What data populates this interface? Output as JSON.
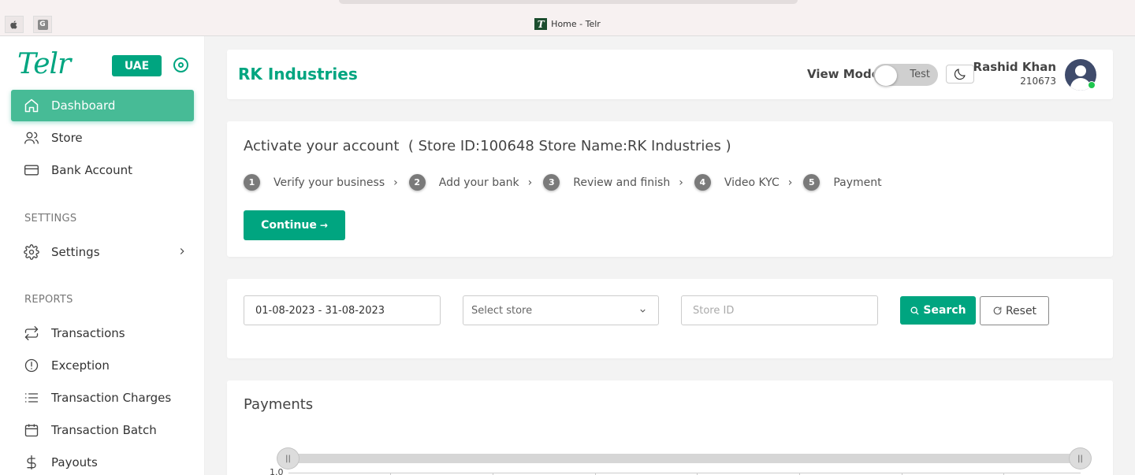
{
  "browser": {
    "tab_title": "Home - Telr",
    "favicon_letter": "T",
    "pinned_tabs": [
      {
        "icon": "apple-icon",
        "glyph": ""
      },
      {
        "icon": "g-icon",
        "glyph": "G"
      }
    ]
  },
  "sidebar": {
    "logo": "Telr",
    "region": "UAE",
    "nav": [
      {
        "label": "Dashboard",
        "icon": "home-icon",
        "active": true
      },
      {
        "label": "Store",
        "icon": "users-icon",
        "active": false
      },
      {
        "label": "Bank Account",
        "icon": "credit-card-icon",
        "active": false
      }
    ],
    "settings_section": "SETTINGS",
    "settings_items": [
      {
        "label": "Settings",
        "icon": "gear-icon",
        "has_submenu": true
      }
    ],
    "reports_section": "REPORTS",
    "reports_items": [
      {
        "label": "Transactions",
        "icon": "swap-icon"
      },
      {
        "label": "Exception",
        "icon": "alert-circle-icon"
      },
      {
        "label": "Transaction Charges",
        "icon": "list-icon"
      },
      {
        "label": "Transaction Batch",
        "icon": "calendar-icon"
      },
      {
        "label": "Payouts",
        "icon": "dollar-icon"
      }
    ]
  },
  "header": {
    "company": "RK Industries",
    "view_mode_label": "View Mode",
    "toggle_text": "Test",
    "user_name": "Rashid Khan",
    "user_id": "210673"
  },
  "activate": {
    "title": "Activate your account  ( Store ID:100648 Store Name:RK Industries )",
    "steps": [
      {
        "num": "1",
        "label": "Verify your business"
      },
      {
        "num": "2",
        "label": "Add your bank"
      },
      {
        "num": "3",
        "label": "Review and finish"
      },
      {
        "num": "4",
        "label": "Video KYC"
      },
      {
        "num": "5",
        "label": "Payment"
      }
    ],
    "continue_label": "Continue",
    "continue_arrow": "→"
  },
  "filters": {
    "date_range": "01-08-2023 - 31-08-2023",
    "store_placeholder": "Select store",
    "store_id_placeholder": "Store ID",
    "search_label": "Search",
    "reset_label": "Reset"
  },
  "payments": {
    "title": "Payments",
    "y_first_tick": "1.0",
    "range_handle_glyph": "||"
  },
  "colors": {
    "brand": "#00a580",
    "active_nav": "#47bb96",
    "online": "#1ec64e"
  }
}
